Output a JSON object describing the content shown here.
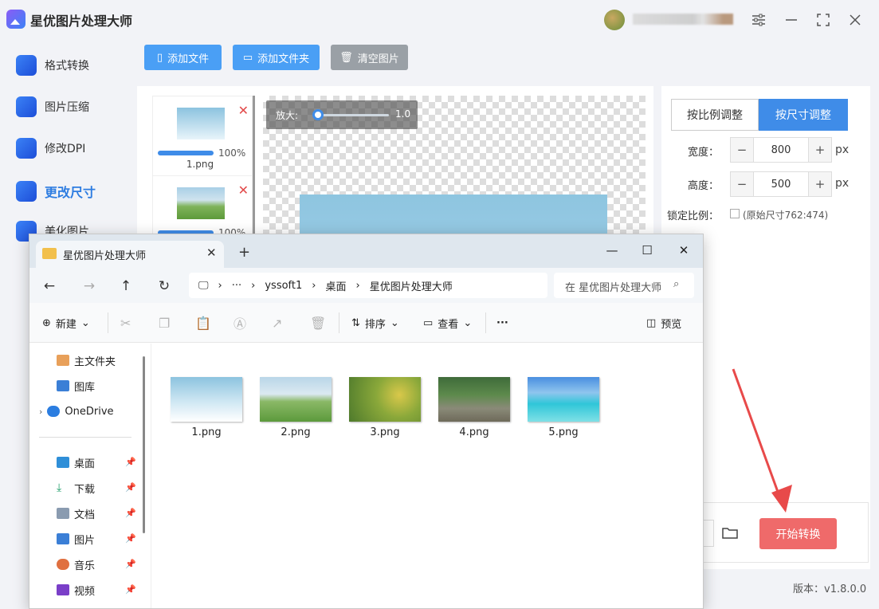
{
  "app": {
    "title": "星优图片处理大师",
    "version": "版本：v1.8.0.0"
  },
  "sidebar": {
    "items": [
      {
        "label": "格式转换"
      },
      {
        "label": "图片压缩"
      },
      {
        "label": "修改DPI"
      },
      {
        "label": "更改尺寸"
      },
      {
        "label": "美化图片"
      }
    ]
  },
  "toolbar": {
    "add_file": "添加文件",
    "add_folder": "添加文件夹",
    "clear": "清空图片"
  },
  "thumbnails": [
    {
      "name": "1.png",
      "progress": "100%"
    },
    {
      "name": "",
      "progress": "100%"
    }
  ],
  "zoom": {
    "label": "放大:",
    "value": "1.0"
  },
  "settings": {
    "mode_ratio": "按比例调整",
    "mode_size": "按尺寸调整",
    "width_label": "宽度：",
    "width_value": "800",
    "height_label": "高度：",
    "height_value": "500",
    "unit": "px",
    "lock_label": "锁定比例：",
    "original_size": "(原始尺寸762:474)",
    "minus": "−",
    "plus": "+"
  },
  "start_button": "开始转换",
  "explorer": {
    "tab_title": "星优图片处理大师",
    "new_tab": "+",
    "breadcrumb": [
      "yssoft1",
      "桌面",
      "星优图片处理大师"
    ],
    "search_placeholder": "在 星优图片处理大师 中搜索",
    "toolbar": {
      "new": "新建",
      "sort": "排序",
      "view": "查看",
      "more": "···",
      "preview": "预览"
    },
    "nav": {
      "home": "主文件夹",
      "gallery": "图库",
      "onedrive": "OneDrive",
      "desktop": "桌面",
      "downloads": "下载",
      "documents": "文档",
      "pictures": "图片",
      "music": "音乐",
      "videos": "视频"
    },
    "files": [
      "1.png",
      "2.png",
      "3.png",
      "4.png",
      "5.png"
    ]
  },
  "colors": {
    "accent": "#3f8ce8",
    "start": "#ef6a6a",
    "arrow": "#e84a4a"
  }
}
